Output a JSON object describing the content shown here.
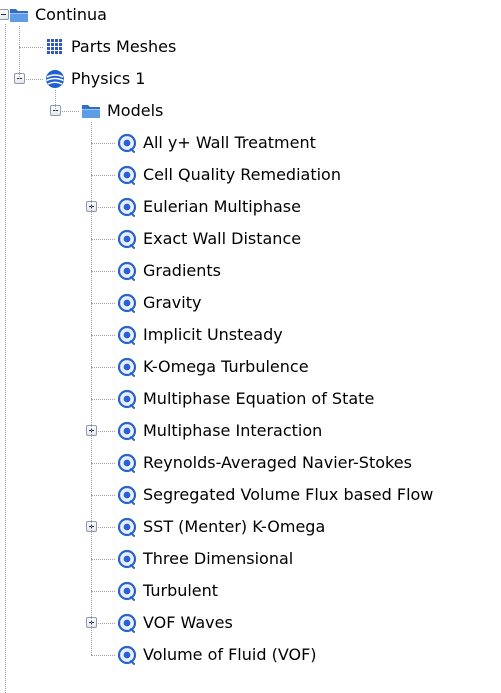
{
  "tree": {
    "root": {
      "label": "Continua",
      "icon": "folder-icon",
      "expanded": true,
      "children": [
        {
          "label": "Parts Meshes",
          "icon": "mesh-grid-icon",
          "expandable": false
        },
        {
          "label": "Physics 1",
          "icon": "physics-sphere-icon",
          "expanded": true,
          "children": [
            {
              "label": "Models",
              "icon": "folder-icon",
              "expanded": true,
              "children": [
                {
                  "label": "All y+ Wall Treatment",
                  "icon": "model-icon",
                  "expandable": false
                },
                {
                  "label": "Cell Quality Remediation",
                  "icon": "model-icon",
                  "expandable": false
                },
                {
                  "label": "Eulerian Multiphase",
                  "icon": "model-icon",
                  "expandable": true
                },
                {
                  "label": "Exact Wall Distance",
                  "icon": "model-icon",
                  "expandable": false
                },
                {
                  "label": "Gradients",
                  "icon": "model-icon",
                  "expandable": false
                },
                {
                  "label": "Gravity",
                  "icon": "model-icon",
                  "expandable": false
                },
                {
                  "label": "Implicit Unsteady",
                  "icon": "model-icon",
                  "expandable": false
                },
                {
                  "label": "K-Omega Turbulence",
                  "icon": "model-icon",
                  "expandable": false
                },
                {
                  "label": "Multiphase Equation of State",
                  "icon": "model-icon",
                  "expandable": false
                },
                {
                  "label": "Multiphase Interaction",
                  "icon": "model-icon",
                  "expandable": true
                },
                {
                  "label": "Reynolds-Averaged Navier-Stokes",
                  "icon": "model-icon",
                  "expandable": false
                },
                {
                  "label": "Segregated Volume Flux based Flow",
                  "icon": "model-icon",
                  "expandable": false
                },
                {
                  "label": "SST (Menter) K-Omega",
                  "icon": "model-icon",
                  "expandable": true
                },
                {
                  "label": "Three Dimensional",
                  "icon": "model-icon",
                  "expandable": false
                },
                {
                  "label": "Turbulent",
                  "icon": "model-icon",
                  "expandable": false
                },
                {
                  "label": "VOF Waves",
                  "icon": "model-icon",
                  "expandable": true
                },
                {
                  "label": "Volume of Fluid (VOF)",
                  "icon": "model-icon",
                  "expandable": false
                }
              ]
            }
          ]
        }
      ]
    }
  },
  "colors": {
    "folder": "#2f6fc9",
    "folder_light": "#5f9de6",
    "mesh": "#2e58c8",
    "sphere": "#1f5fd1",
    "model_ring": "#2a63c9",
    "connector": "#a0a0a0"
  }
}
